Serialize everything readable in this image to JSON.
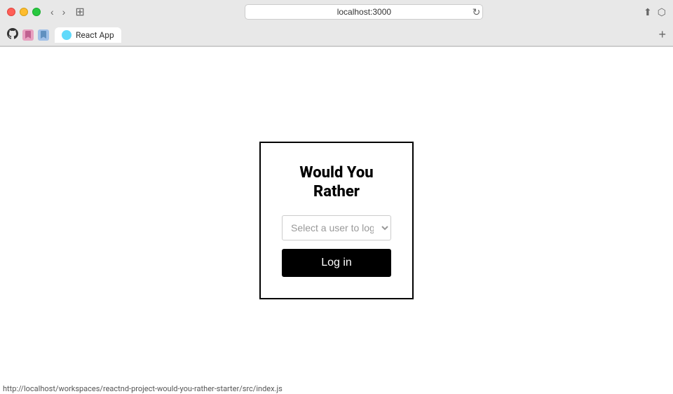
{
  "browser": {
    "address": "localhost:3000",
    "tab_title": "React App",
    "status_url": "http://localhost/workspaces/reactnd-project-would-you-rather-starter/src/index.js"
  },
  "nav": {
    "back_label": "‹",
    "forward_label": "›",
    "refresh_label": "↻",
    "sidebar_label": "⊞",
    "share_label": "⬆",
    "fullscreen_label": "⬡",
    "add_tab_label": "+"
  },
  "card": {
    "title": "Would You Rather",
    "select_placeholder": "Select a user to log in",
    "login_button": "Log in"
  },
  "icons": {
    "github": "⊙",
    "wavy1": "w",
    "wavy2": "w",
    "react": "⚛"
  }
}
